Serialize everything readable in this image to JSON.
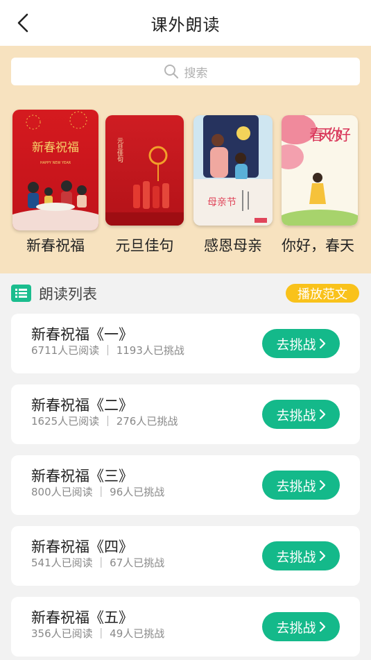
{
  "header": {
    "title": "课外朗读",
    "back_icon": "chevron-left-icon"
  },
  "search": {
    "placeholder": "搜索",
    "icon": "search-icon"
  },
  "categories": [
    {
      "label": "新春祝福",
      "cover_heading": "新春祝福",
      "cover_subtitle": "HAPPY NEW YEAR"
    },
    {
      "label": "元旦佳句",
      "cover_heading": "元旦佳句"
    },
    {
      "label": "感恩母亲",
      "cover_heading": "母亲节"
    },
    {
      "label": "你好，春天",
      "cover_heading": "春天你好"
    }
  ],
  "list": {
    "title": "朗读列表",
    "play_label": "播放范文",
    "challenge_label": "去挑战",
    "items": [
      {
        "title": "新春祝福《一》",
        "stats": "6711人已阅读 ｜ 1193人已挑战"
      },
      {
        "title": "新春祝福《二》",
        "stats": "1625人已阅读 ｜ 276人已挑战"
      },
      {
        "title": "新春祝福《三》",
        "stats": "800人已阅读 ｜ 96人已挑战"
      },
      {
        "title": "新春祝福《四》",
        "stats": "541人已阅读 ｜ 67人已挑战"
      },
      {
        "title": "新春祝福《五》",
        "stats": "356人已阅读 ｜ 49人已挑战"
      }
    ]
  },
  "colors": {
    "accent_green": "#14b98a",
    "accent_yellow": "#f9c21b",
    "hero_bg": "#f7e2bf"
  }
}
